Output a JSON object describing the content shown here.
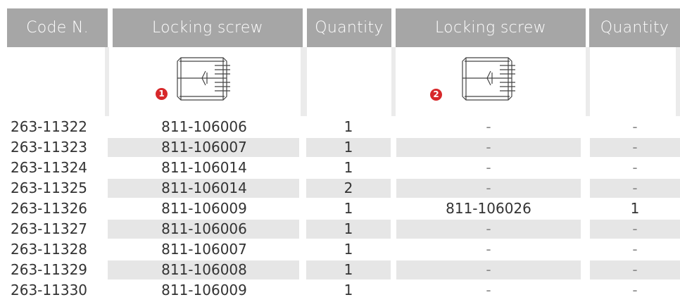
{
  "headers": [
    "Code N.",
    "Locking screw",
    "Quantity",
    "Locking screw",
    "Quantity"
  ],
  "markers": [
    "1",
    "2"
  ],
  "rows": [
    [
      "263-11322",
      "811-106006",
      "1",
      "-",
      "-"
    ],
    [
      "263-11323",
      "811-106007",
      "1",
      "-",
      "-"
    ],
    [
      "263-11324",
      "811-106014",
      "1",
      "-",
      "-"
    ],
    [
      "263-11325",
      "811-106014",
      "2",
      "-",
      "-"
    ],
    [
      "263-11326",
      "811-106009",
      "1",
      "811-106026",
      "1"
    ],
    [
      "263-11327",
      "811-106006",
      "1",
      "-",
      "-"
    ],
    [
      "263-11328",
      "811-106007",
      "1",
      "-",
      "-"
    ],
    [
      "263-11329",
      "811-106008",
      "1",
      "-",
      "-"
    ],
    [
      "263-11330",
      "811-106009",
      "1",
      "-",
      "-"
    ]
  ],
  "colors": {
    "header_bg": "#a6a6a6",
    "row_shade": "#e6e6e6",
    "badge": "#d7282a"
  }
}
